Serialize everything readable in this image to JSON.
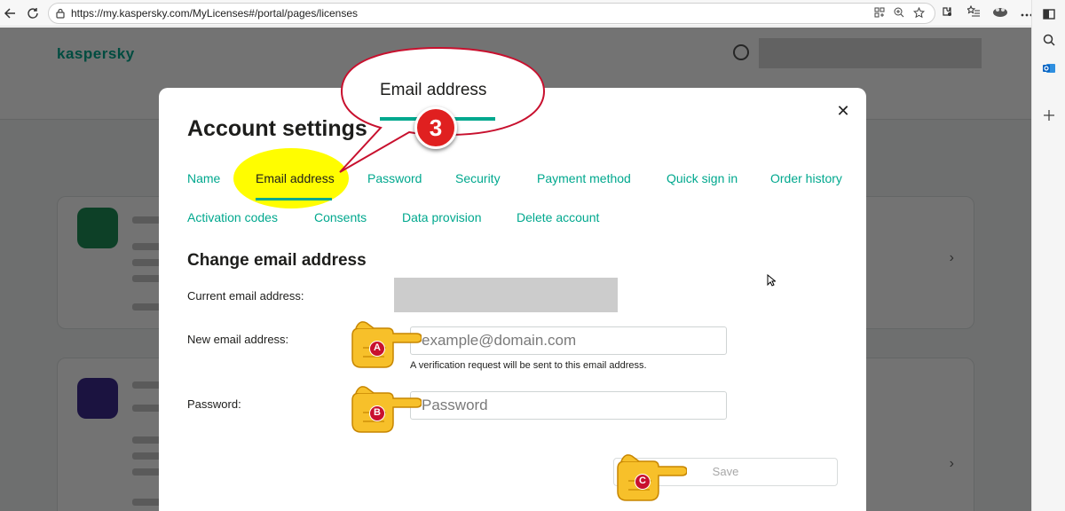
{
  "browser": {
    "url": "https://my.kaspersky.com/MyLicenses#/portal/pages/licenses",
    "icons": [
      "back-icon",
      "refresh-icon",
      "lock-icon",
      "apps-icon",
      "zoom-icon",
      "favorite-icon",
      "extension-icon",
      "favorites-list-icon",
      "profile-icon",
      "more-icon"
    ],
    "rail_icons": [
      "sidebar-icon",
      "search-icon",
      "outlook-icon",
      "add-icon"
    ]
  },
  "modal": {
    "title": "Account settings",
    "tabs": [
      {
        "label": "Name"
      },
      {
        "label": "Email address",
        "active": true
      },
      {
        "label": "Password"
      },
      {
        "label": "Security"
      },
      {
        "label": "Payment method"
      },
      {
        "label": "Quick sign in"
      },
      {
        "label": "Order history"
      },
      {
        "label": "Activation codes"
      },
      {
        "label": "Consents"
      },
      {
        "label": "Data provision"
      },
      {
        "label": "Delete account"
      }
    ],
    "section_title": "Change email address",
    "current_email_label": "Current email address:",
    "new_email_label": "New email address:",
    "new_email_placeholder": "example@domain.com",
    "hint": "A verification request will be sent to this email address.",
    "password_label": "Password:",
    "password_placeholder": "Password",
    "save_label": "Save"
  },
  "annotations": {
    "callout_text": "Email address",
    "step_number": "3",
    "markers": [
      "A",
      "B",
      "C"
    ]
  },
  "colors": {
    "accent": "#00a88e",
    "highlight": "#fffd00",
    "badge": "#e02020",
    "hand": "#f7c02a"
  }
}
